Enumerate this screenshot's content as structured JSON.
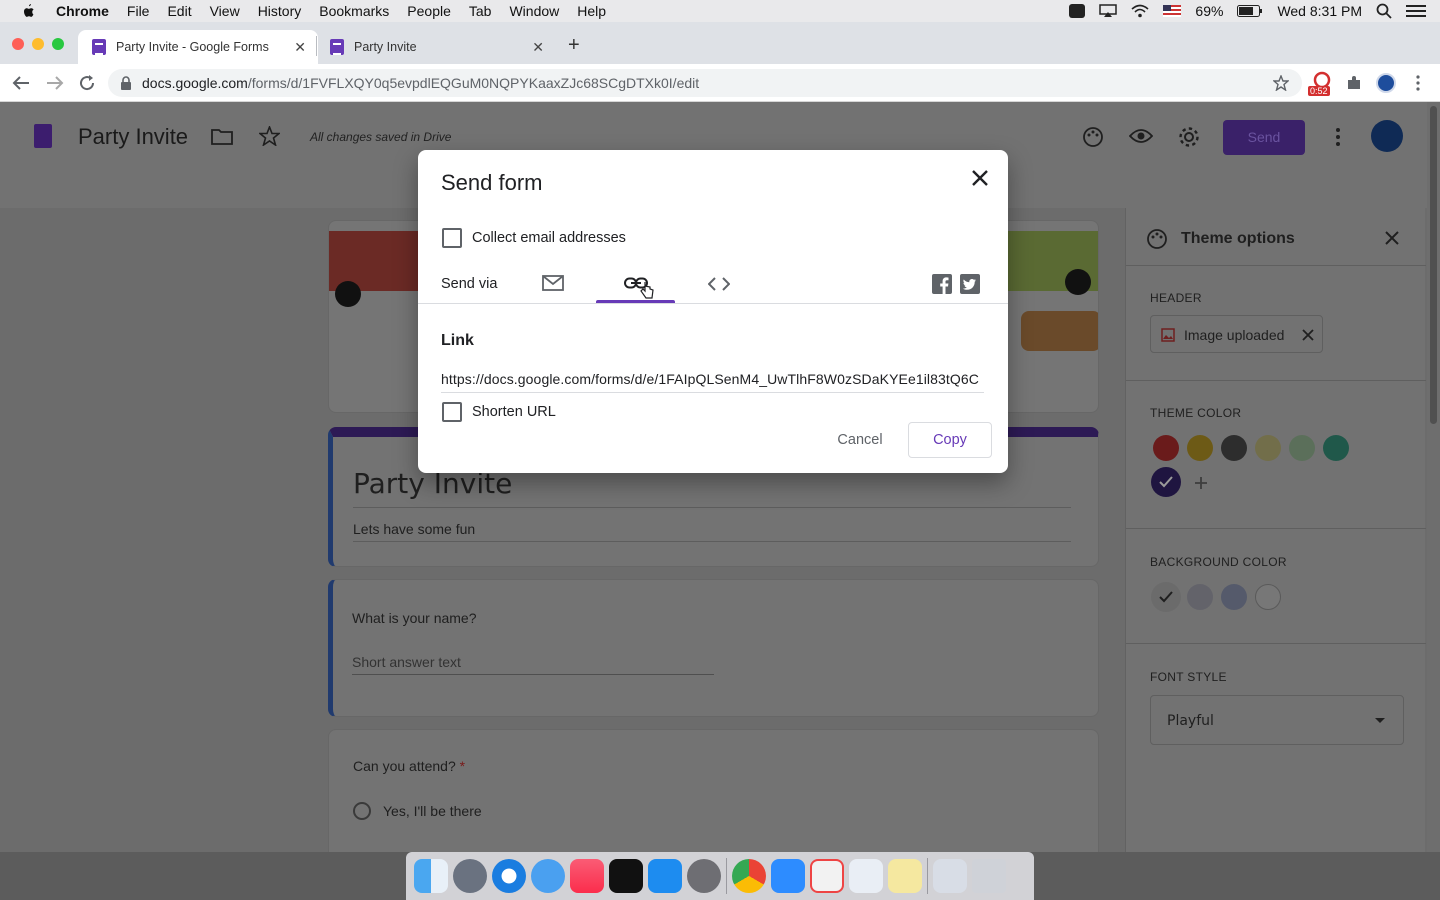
{
  "menubar": {
    "app_name": "Chrome",
    "items": [
      "File",
      "Edit",
      "View",
      "History",
      "Bookmarks",
      "People",
      "Tab",
      "Window",
      "Help"
    ],
    "battery": "69%",
    "clock": "Wed 8:31 PM"
  },
  "browser": {
    "tabs": [
      {
        "title": "Party Invite - Google Forms",
        "active": true
      },
      {
        "title": "Party Invite",
        "active": false
      }
    ],
    "url_host": "docs.google.com",
    "url_path": "/forms/d/1FVFLXQY0q5evpdlEQGuM0NQPYKaaxZJc68SCgDTXk0I/edit",
    "extension_badge": "0:52"
  },
  "forms_header": {
    "title": "Party Invite",
    "saved_status": "All changes saved in Drive",
    "send_label": "Send"
  },
  "form": {
    "title": "Party Invite",
    "description": "Lets have some fun",
    "q1": {
      "title": "What is your name?",
      "placeholder": "Short answer text"
    },
    "q2": {
      "title": "Can you attend?",
      "required_mark": "*",
      "option1": "Yes,  I'll be there"
    }
  },
  "theme_panel": {
    "title": "Theme options",
    "header_label": "HEADER",
    "header_chip": "Image uploaded",
    "theme_color_label": "THEME COLOR",
    "theme_colors": [
      "#b02020",
      "#c39a16",
      "#3a3a3a",
      "#b8b060",
      "#8fb08e",
      "#2f8f77",
      "#3b2a7a"
    ],
    "background_color_label": "BACKGROUND COLOR",
    "background_colors": [
      "#6f6f6f",
      "#8a8a8f",
      "#7a7f93",
      "#9a9a9a"
    ],
    "font_style_label": "FONT STYLE",
    "font_style_value": "Playful"
  },
  "dialog": {
    "title": "Send form",
    "collect_emails_label": "Collect email addresses",
    "send_via_label": "Send via",
    "active_tab": "link",
    "link_heading": "Link",
    "link_url": "https://docs.google.com/forms/d/e/1FAIpQLSenM4_UwTlhF8W0zSDaKYEe1il83tQ6C",
    "shorten_url_label": "Shorten URL",
    "cancel_label": "Cancel",
    "copy_label": "Copy"
  },
  "colors": {
    "accent": "#673ab7"
  }
}
